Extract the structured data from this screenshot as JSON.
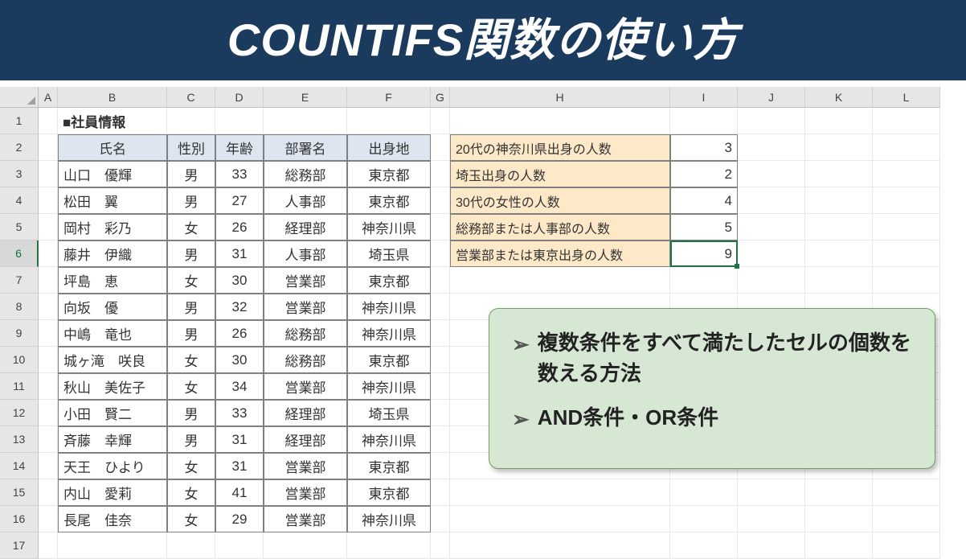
{
  "banner": {
    "title": "COUNTIFS関数の使い方"
  },
  "columns": [
    "A",
    "B",
    "C",
    "D",
    "E",
    "F",
    "G",
    "H",
    "I",
    "J",
    "K",
    "L"
  ],
  "rows": [
    1,
    2,
    3,
    4,
    5,
    6,
    7,
    8,
    9,
    10,
    11,
    12,
    13,
    14,
    15,
    16,
    17
  ],
  "section_title": "■社員情報",
  "table": {
    "headers": {
      "name": "氏名",
      "gender": "性別",
      "age": "年齢",
      "dept": "部署名",
      "origin": "出身地"
    },
    "data": [
      {
        "name": "山口　優輝",
        "gender": "男",
        "age": "33",
        "dept": "総務部",
        "origin": "東京都"
      },
      {
        "name": "松田　翼",
        "gender": "男",
        "age": "27",
        "dept": "人事部",
        "origin": "東京都"
      },
      {
        "name": "岡村　彩乃",
        "gender": "女",
        "age": "26",
        "dept": "経理部",
        "origin": "神奈川県"
      },
      {
        "name": "藤井　伊織",
        "gender": "男",
        "age": "31",
        "dept": "人事部",
        "origin": "埼玉県"
      },
      {
        "name": "坪島　恵",
        "gender": "女",
        "age": "30",
        "dept": "営業部",
        "origin": "東京都"
      },
      {
        "name": "向坂　優",
        "gender": "男",
        "age": "32",
        "dept": "営業部",
        "origin": "神奈川県"
      },
      {
        "name": "中嶋　竜也",
        "gender": "男",
        "age": "26",
        "dept": "総務部",
        "origin": "神奈川県"
      },
      {
        "name": "城ヶ滝　咲良",
        "gender": "女",
        "age": "30",
        "dept": "総務部",
        "origin": "東京都"
      },
      {
        "name": "秋山　美佐子",
        "gender": "女",
        "age": "34",
        "dept": "営業部",
        "origin": "神奈川県"
      },
      {
        "name": "小田　賢二",
        "gender": "男",
        "age": "33",
        "dept": "経理部",
        "origin": "埼玉県"
      },
      {
        "name": "斉藤　幸輝",
        "gender": "男",
        "age": "31",
        "dept": "経理部",
        "origin": "神奈川県"
      },
      {
        "name": "天王　ひより",
        "gender": "女",
        "age": "31",
        "dept": "営業部",
        "origin": "東京都"
      },
      {
        "name": "内山　愛莉",
        "gender": "女",
        "age": "41",
        "dept": "営業部",
        "origin": "東京都"
      },
      {
        "name": "長尾　佳奈",
        "gender": "女",
        "age": "29",
        "dept": "営業部",
        "origin": "神奈川県"
      }
    ]
  },
  "summary": [
    {
      "label": "20代の神奈川県出身の人数",
      "value": "3"
    },
    {
      "label": "埼玉出身の人数",
      "value": "2"
    },
    {
      "label": "30代の女性の人数",
      "value": "4"
    },
    {
      "label": "総務部または人事部の人数",
      "value": "5"
    },
    {
      "label": "営業部または東京出身の人数",
      "value": "9"
    }
  ],
  "notes": {
    "bullet1": "複数条件をすべて満たしたセルの個数を数える方法",
    "bullet2": "AND条件・OR条件"
  },
  "active_cell": "I6"
}
